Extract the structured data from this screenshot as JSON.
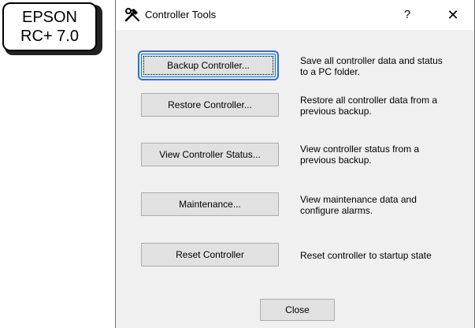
{
  "badge": {
    "line1": "EPSON",
    "line2": "RC+ 7.0"
  },
  "window": {
    "title": "Controller Tools",
    "title_icon": "tools-icon",
    "help_label": "?",
    "close_label": "✕"
  },
  "tools": [
    {
      "button_label": "Backup Controller...",
      "description_line1": "Save all controller data and status",
      "description_line2": "to a PC folder."
    },
    {
      "button_label": "Restore Controller...",
      "description_line1": "Restore all controller data from a",
      "description_line2": "previous backup."
    },
    {
      "button_label": "View Controller Status...",
      "description_line1": "View controller status from a",
      "description_line2": "previous backup."
    },
    {
      "button_label": "Maintenance...",
      "description_line1": "View maintenance data and",
      "description_line2": "configure alarms."
    },
    {
      "button_label": "Reset Controller",
      "description_line1": "Reset controller to startup state",
      "description_line2": ""
    }
  ],
  "footer": {
    "close_label": "Close"
  }
}
